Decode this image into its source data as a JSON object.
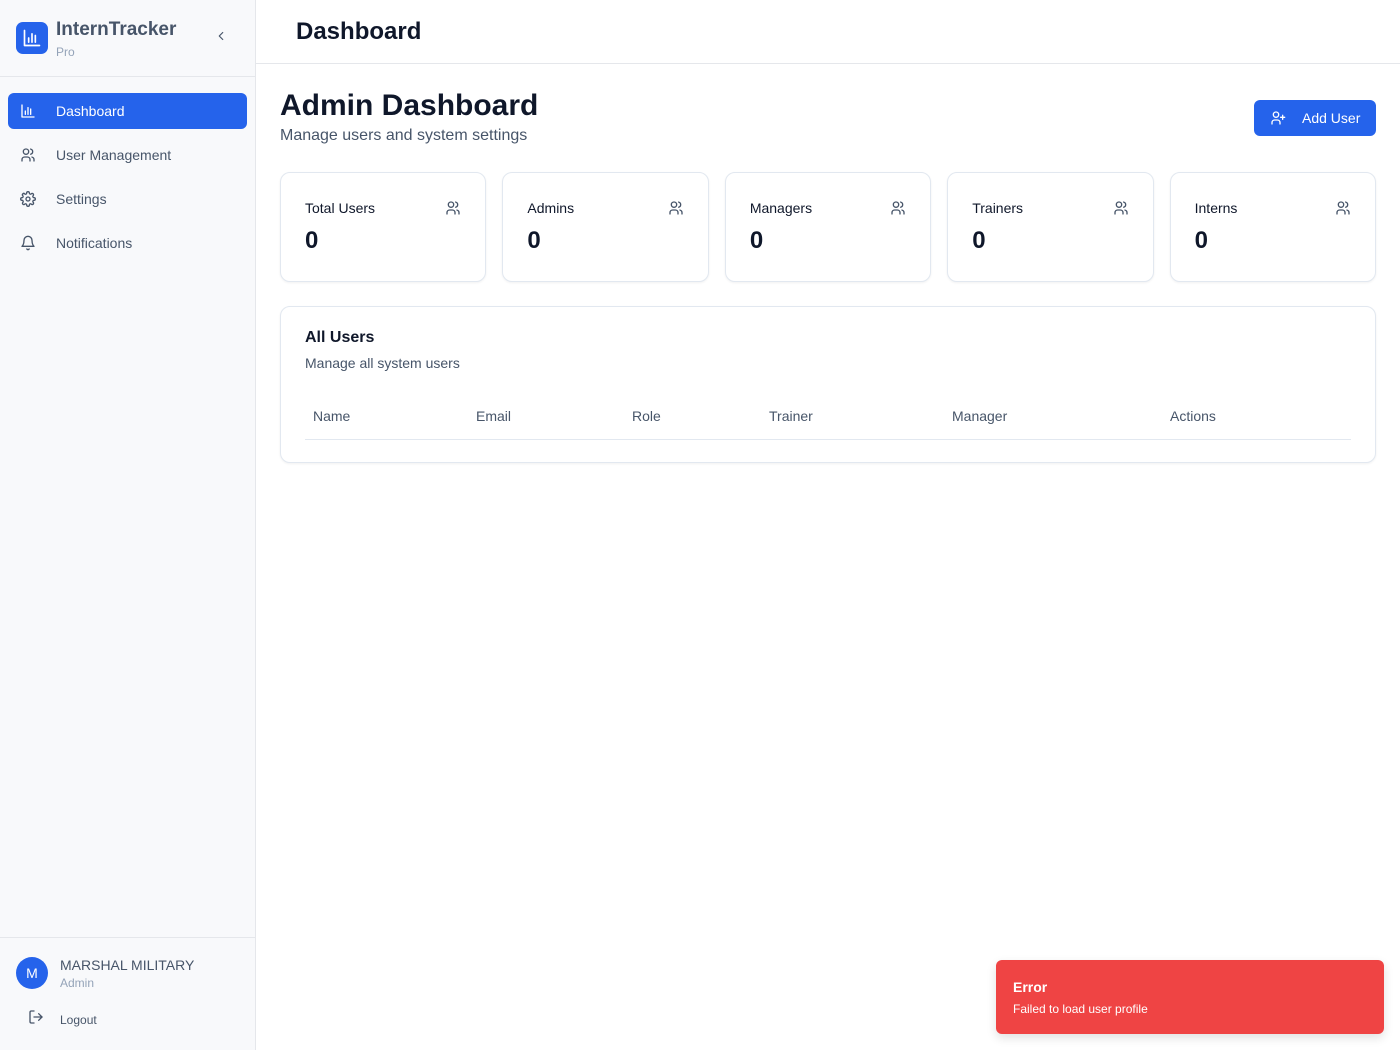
{
  "brand": {
    "name": "InternTracker",
    "tier": "Pro"
  },
  "sidebar": {
    "items": [
      {
        "label": "Dashboard",
        "icon": "bar-chart-icon",
        "active": true
      },
      {
        "label": "User Management",
        "icon": "users-icon",
        "active": false
      },
      {
        "label": "Settings",
        "icon": "gear-icon",
        "active": false
      },
      {
        "label": "Notifications",
        "icon": "bell-icon",
        "active": false
      }
    ]
  },
  "user": {
    "initial": "M",
    "name": "MARSHAL MILITARY",
    "role": "Admin",
    "logout_label": "Logout"
  },
  "header": {
    "title": "Dashboard"
  },
  "main": {
    "title": "Admin Dashboard",
    "subtitle": "Manage users and system settings",
    "add_user_label": "Add User",
    "stats": [
      {
        "label": "Total Users",
        "value": "0"
      },
      {
        "label": "Admins",
        "value": "0"
      },
      {
        "label": "Managers",
        "value": "0"
      },
      {
        "label": "Trainers",
        "value": "0"
      },
      {
        "label": "Interns",
        "value": "0"
      }
    ],
    "users_table": {
      "title": "All Users",
      "subtitle": "Manage all system users",
      "columns": [
        "Name",
        "Email",
        "Role",
        "Trainer",
        "Manager",
        "Actions"
      ],
      "rows": []
    }
  },
  "toast": {
    "title": "Error",
    "message": "Failed to load user profile"
  },
  "colors": {
    "accent": "#2563eb",
    "error": "#ef4444",
    "sidebar_bg": "#f8f9fb",
    "border": "#e5e7eb"
  }
}
